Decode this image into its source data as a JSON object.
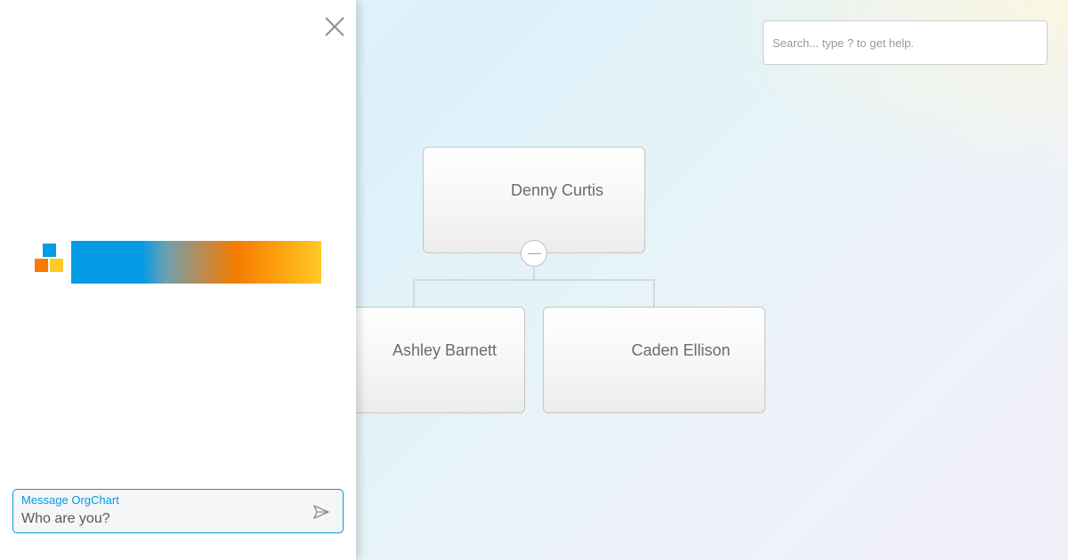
{
  "search": {
    "placeholder": "Search... type ? to get help."
  },
  "org_chart": {
    "nodes": [
      {
        "name": "Denny Curtis",
        "level": 0
      },
      {
        "name": "Ashley Barnett",
        "level": 1,
        "parent": "Denny Curtis"
      },
      {
        "name": "Caden Ellison",
        "level": 1,
        "parent": "Denny Curtis"
      }
    ],
    "collapse_icon": "minus-circle-icon"
  },
  "side_panel": {
    "close_icon": "close-icon",
    "logo_icon": "orgchart-logo-icon",
    "message": {
      "label": "Message OrgChart",
      "value": "Who are you?",
      "send_icon": "send-icon"
    }
  },
  "colors": {
    "accent": "#039be5",
    "logo_orange": "#f57c00",
    "logo_yellow": "#ffca28",
    "node_border": "#c4c4c4",
    "node_text": "#6b6b6b"
  }
}
